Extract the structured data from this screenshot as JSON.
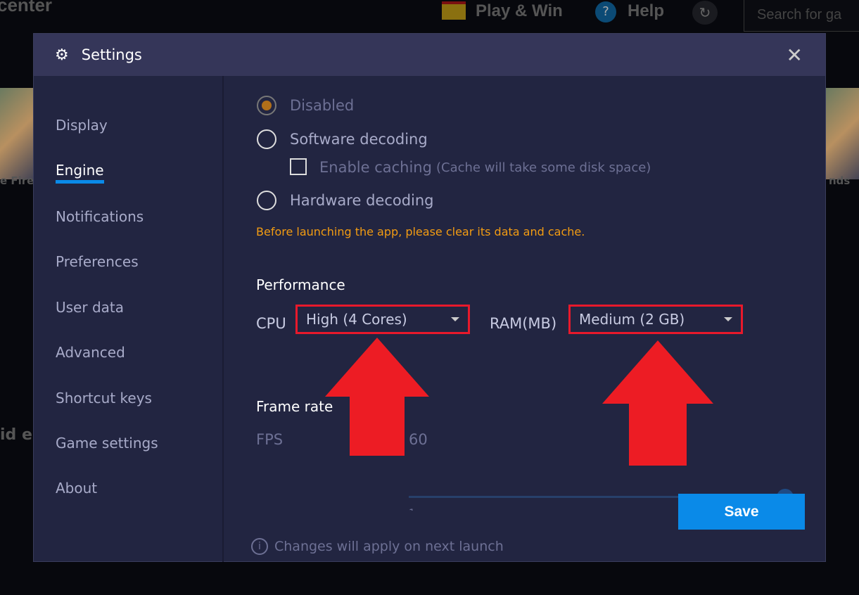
{
  "background": {
    "brand_fragment": "center",
    "play_win": "Play & Win",
    "help": "Help",
    "search_placeholder": "Search for ga",
    "left_game": "e Fire",
    "right_game": "nds",
    "left_text": "id er"
  },
  "dialog": {
    "title": "Settings",
    "icon": "gear-icon",
    "close_icon": "close-icon"
  },
  "sidebar": {
    "items": [
      {
        "label": "Display"
      },
      {
        "label": "Engine",
        "active": true
      },
      {
        "label": "Notifications"
      },
      {
        "label": "Preferences"
      },
      {
        "label": "User data"
      },
      {
        "label": "Advanced"
      },
      {
        "label": "Shortcut keys"
      },
      {
        "label": "Game settings"
      },
      {
        "label": "About"
      }
    ]
  },
  "content": {
    "decoding": {
      "options": [
        {
          "label": "Disabled",
          "selected": true,
          "disabled": true
        },
        {
          "label": "Software decoding",
          "selected": false
        },
        {
          "label": "Hardware decoding",
          "selected": false
        }
      ],
      "caching_label": "Enable caching",
      "caching_note": "(Cache will take some disk space)",
      "caching_checked": false,
      "warning": "Before launching the app, please clear its data and cache."
    },
    "performance": {
      "title": "Performance",
      "cpu_label": "CPU",
      "cpu_value": "High (4 Cores)",
      "ram_label": "RAM(MB)",
      "ram_value": "Medium (2 GB)"
    },
    "frame_rate": {
      "title": "Frame rate",
      "fps_label": "FPS",
      "fps_value": "60",
      "slider_min": "1",
      "slider_max": "60",
      "slider_fraction": 1.0
    },
    "footer_note": "Changes will apply on next launch",
    "save_label": "Save"
  },
  "colors": {
    "accent": "#0a8ae8",
    "warning": "#f39c12",
    "highlight": "#e8192b"
  }
}
